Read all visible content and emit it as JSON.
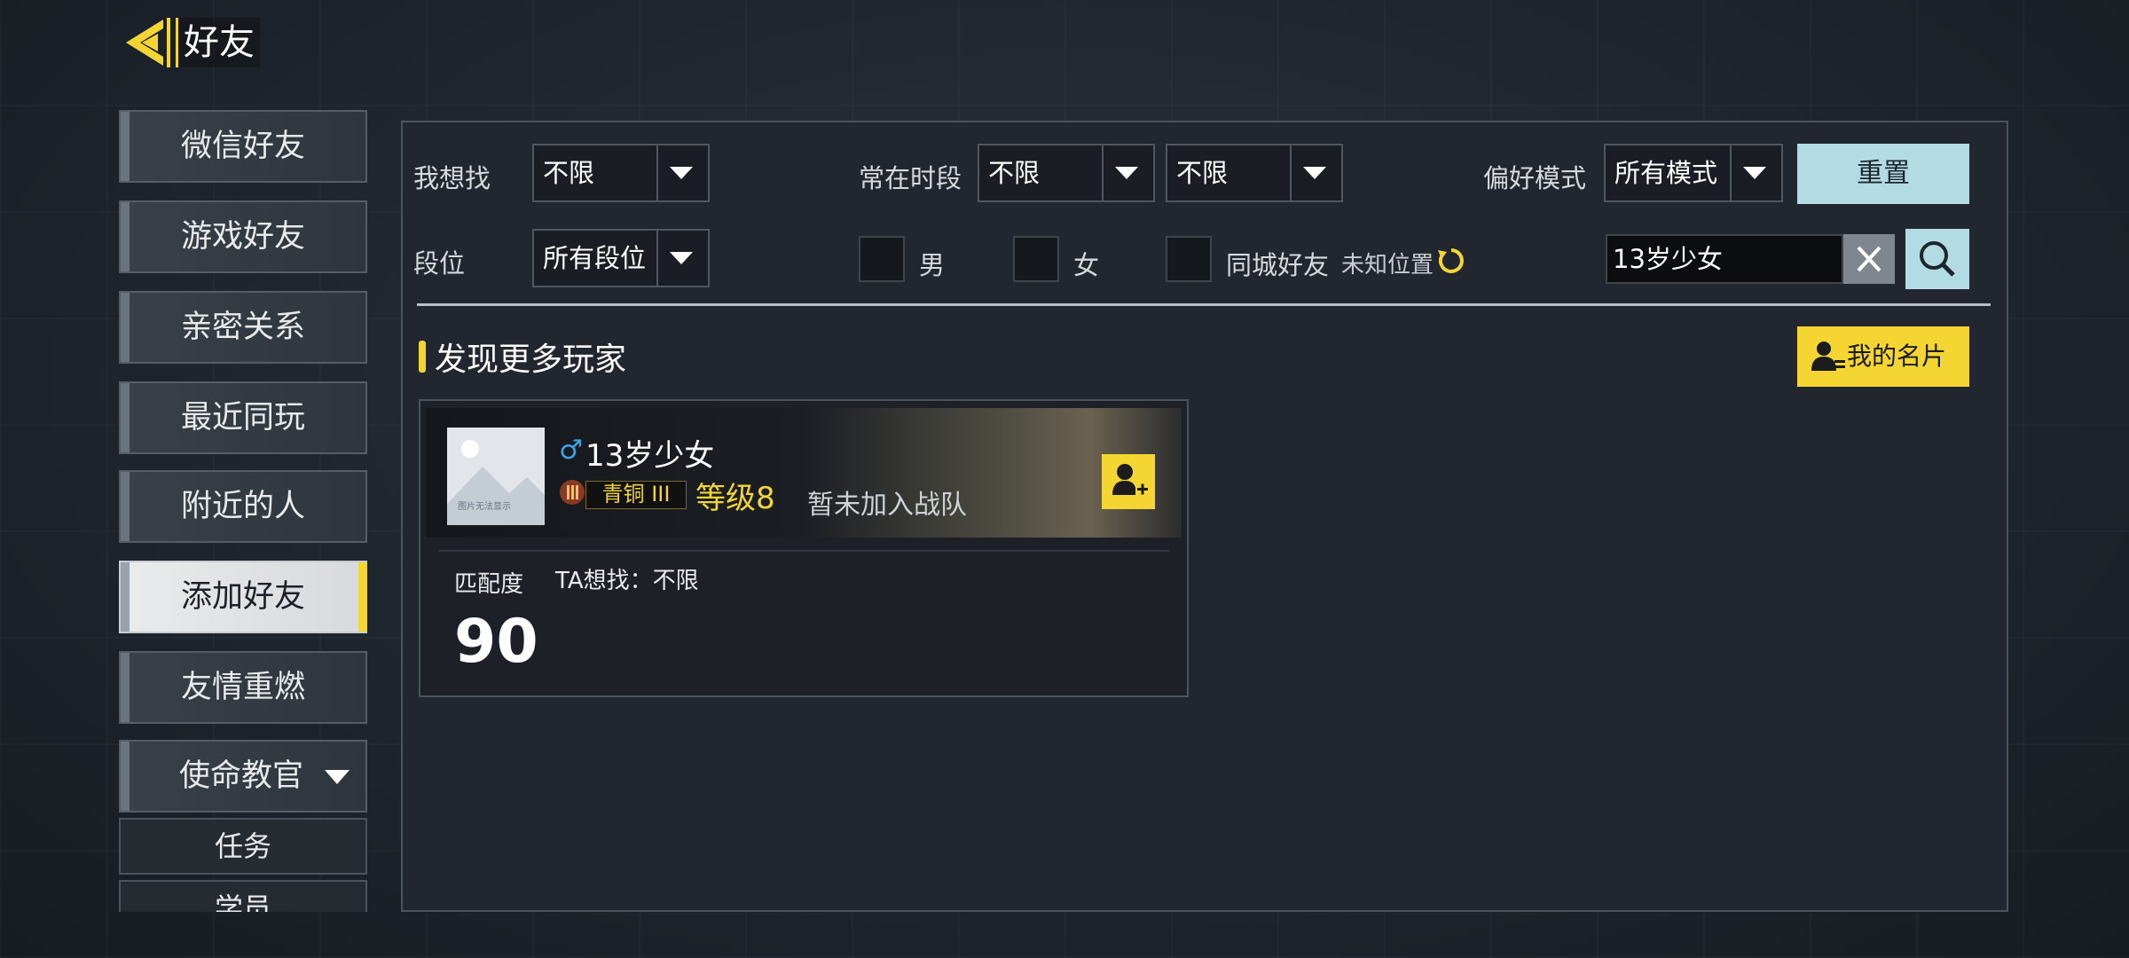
{
  "header": {
    "title": "好友"
  },
  "sidebar": {
    "items": [
      {
        "label": "微信好友"
      },
      {
        "label": "游戏好友"
      },
      {
        "label": "亲密关系"
      },
      {
        "label": "最近同玩"
      },
      {
        "label": "附近的人"
      },
      {
        "label": "添加好友",
        "active": true
      },
      {
        "label": "友情重燃"
      },
      {
        "label": "使命教官",
        "expandable": true
      }
    ],
    "sub_items": [
      {
        "label": "任务"
      },
      {
        "label": "学员"
      }
    ]
  },
  "filters": {
    "looking_for": {
      "label": "我想找",
      "value": "不限"
    },
    "active_time": {
      "label": "常在时段",
      "value_start": "不限",
      "value_end": "不限"
    },
    "preferred_mode": {
      "label": "偏好模式",
      "value": "所有模式"
    },
    "reset_label": "重置",
    "rank": {
      "label": "段位",
      "value": "所有段位"
    },
    "gender_male": "男",
    "gender_female": "女",
    "same_city": "同城好友",
    "location": "未知位置",
    "search_value": "13岁少女"
  },
  "section": {
    "title": "发现更多玩家",
    "my_card_label": "我的名片"
  },
  "player": {
    "avatar_text": "图片无法显示",
    "name": "13岁少女",
    "rank": "青铜 III",
    "level": "等级8",
    "team_status": "暂未加入战队",
    "match_label": "匹配度",
    "wants": "TA想找：不限",
    "match_score": "90"
  },
  "colors": {
    "accent_yellow": "#f4d532",
    "accent_blue": "#b3dbe3",
    "panel_bg": "#22272f"
  },
  "icons": [
    "back-arrow-icon",
    "dropdown-arrow-icon",
    "refresh-icon",
    "clear-icon",
    "search-icon",
    "id-card-icon",
    "male-icon",
    "rank-emblem-icon",
    "add-friend-icon"
  ]
}
